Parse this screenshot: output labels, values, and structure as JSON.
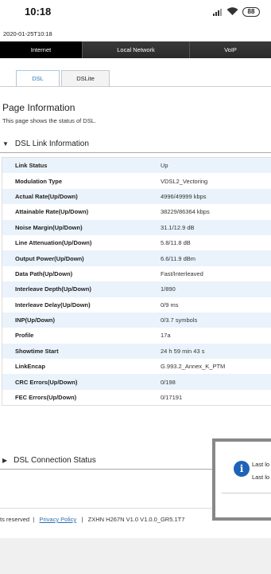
{
  "status_bar": {
    "time": "10:18",
    "battery": "88"
  },
  "timestamp": "2020-01-25T10:18",
  "main_nav": {
    "items": [
      "Internet",
      "Local Network",
      "VoIP"
    ]
  },
  "sub_tabs": [
    "DSL",
    "DSLite"
  ],
  "page_info": {
    "title": "Page Information",
    "description": "This page shows the status of DSL."
  },
  "link_section": {
    "title": "DSL Link Information"
  },
  "link_table": [
    {
      "label": "Link Status",
      "value": "Up"
    },
    {
      "label": "Modulation Type",
      "value": "VDSL2_Vectoring"
    },
    {
      "label": "Actual Rate(Up/Down)",
      "value": "4996/49999 kbps"
    },
    {
      "label": "Attainable Rate(Up/Down)",
      "value": "38229/86364 kbps"
    },
    {
      "label": "Noise Margin(Up/Down)",
      "value": "31.1/12.9 dB"
    },
    {
      "label": "Line Attenuation(Up/Down)",
      "value": "5.8/11.8 dB"
    },
    {
      "label": "Output Power(Up/Down)",
      "value": "6.6/11.9 dBm"
    },
    {
      "label": "Data Path(Up/Down)",
      "value": "Fast/Interleaved"
    },
    {
      "label": "Interleave Depth(Up/Down)",
      "value": "1/890"
    },
    {
      "label": "Interleave Delay(Up/Down)",
      "value": "0/9 ms"
    },
    {
      "label": "INP(Up/Down)",
      "value": "0/3.7 symbols"
    },
    {
      "label": "Profile",
      "value": "17a"
    },
    {
      "label": "Showtime Start",
      "value": "24 h 59 min 43 s"
    },
    {
      "label": "LinkEncap",
      "value": "G.993.2_Annex_K_PTM"
    },
    {
      "label": "CRC Errors(Up/Down)",
      "value": "0/198"
    },
    {
      "label": "FEC Errors(Up/Down)",
      "value": "0/17191"
    }
  ],
  "connection_section": {
    "title": "DSL Connection Status"
  },
  "footer": {
    "rights": "ts reserved",
    "privacy": "Privacy Policy",
    "model": "ZXHN H267N V1.0 V1.0.0_GR5.1T7"
  },
  "popup": {
    "line1": "Last lo",
    "line2": "Last lo"
  },
  "colors": {
    "accent": "#2a7ab8",
    "nav_bg": "#2b2b2b",
    "row_alt": "#eaf3fc",
    "info_icon": "#1e63b8"
  }
}
